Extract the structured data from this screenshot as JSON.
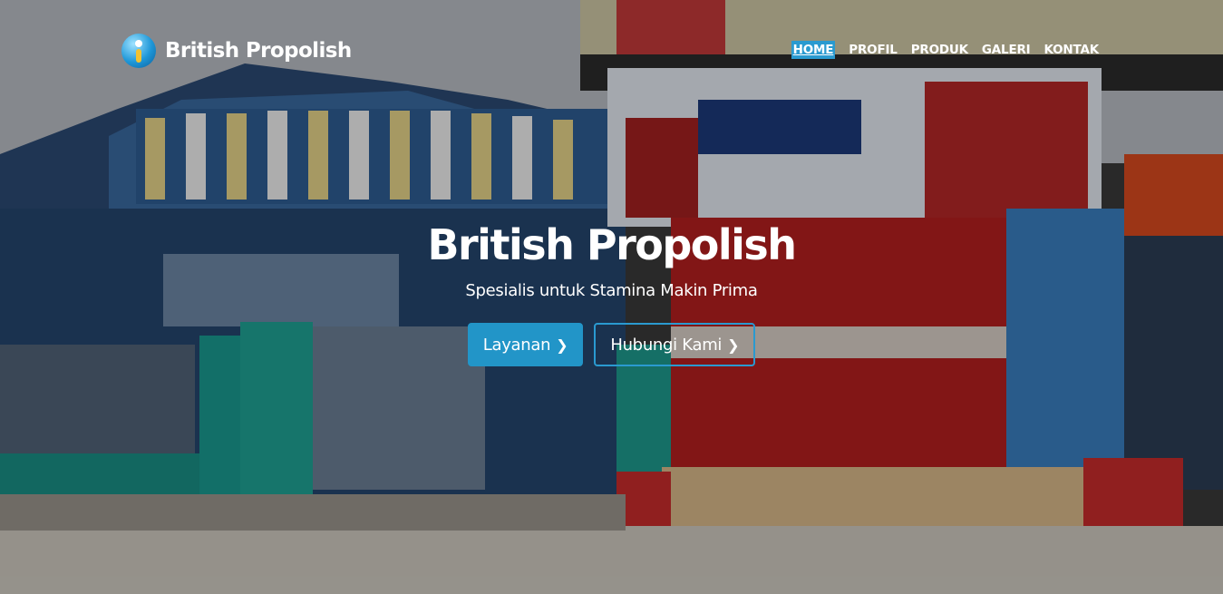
{
  "brand": {
    "name": "British Propolish",
    "logo_icon": "info-person-icon"
  },
  "nav": {
    "items": [
      {
        "label": "HOME",
        "active": true
      },
      {
        "label": "PROFIL",
        "active": false
      },
      {
        "label": "PRODUK",
        "active": false
      },
      {
        "label": "GALERI",
        "active": false
      },
      {
        "label": "KONTAK",
        "active": false
      }
    ]
  },
  "hero": {
    "title": "British Propolish",
    "subtitle": "Spesialis untuk Stamina Makin Prima",
    "primary_button": "Layanan",
    "secondary_button": "Hubungi Kami",
    "button_icon": "chevron-right-icon"
  },
  "colors": {
    "accent": "#2295c8",
    "text": "#ffffff"
  }
}
